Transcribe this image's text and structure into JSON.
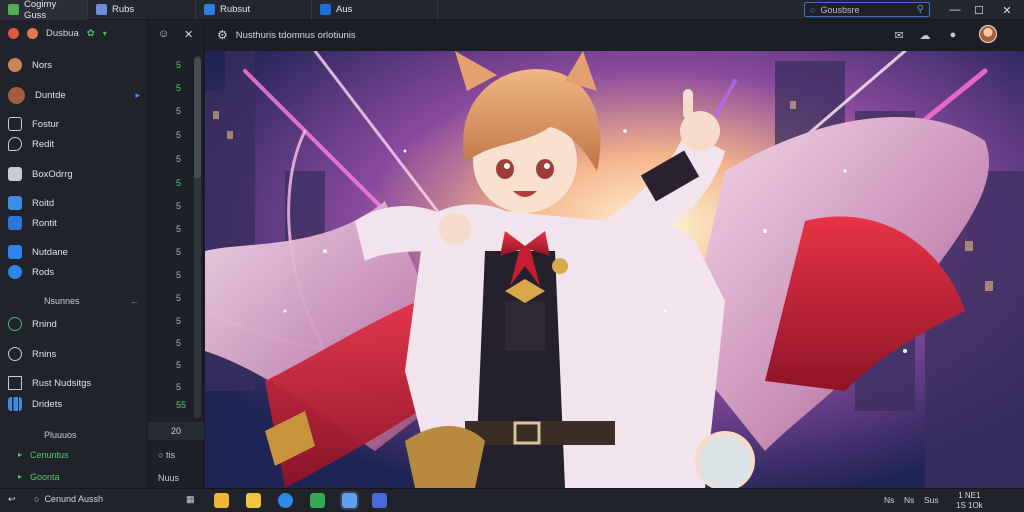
{
  "titlebar": {
    "tabs": [
      {
        "label": "Cogimy Guss",
        "icon_color": "#4caf50"
      },
      {
        "label": "Rubs",
        "icon_color": "#6b8cd6"
      },
      {
        "label": "Rubsut",
        "icon_color": "#2f7de1"
      },
      {
        "label": "Aus",
        "icon_color": "#1d6fe0"
      }
    ],
    "search_placeholder": "Gousbsre",
    "window_controls": [
      "minimize",
      "maximize",
      "close"
    ]
  },
  "sidebar": {
    "account_label": "Dusbua",
    "items": [
      {
        "label": "Nors",
        "icon": "avatar-icon",
        "color": "#c7855a"
      },
      {
        "label": "Duntde",
        "icon": "avatar-icon",
        "color": "#a65d3f",
        "chevron": true
      },
      {
        "label": "Fostur",
        "icon": "message-icon",
        "color": "#c8ccd2"
      },
      {
        "label": "Redit",
        "icon": "chat-icon",
        "color": "#c8ccd2"
      },
      {
        "label": "BoxOdrrg",
        "icon": "box-icon",
        "color": "#c8ccd2"
      },
      {
        "label": "Roitd",
        "icon": "cube-icon",
        "color": "#3b8de6"
      },
      {
        "label": "Rontit",
        "icon": "bag-icon",
        "color": "#2b78d8"
      },
      {
        "label": "Nutdane",
        "icon": "grid-icon",
        "color": "#2f86e8"
      },
      {
        "label": "Rods",
        "icon": "globe-icon",
        "color": "#2f86e8"
      }
    ],
    "section1": "Nsunnes",
    "items2": [
      {
        "label": "Rnind",
        "icon": "refresh-icon",
        "color": "#4fb36d"
      },
      {
        "label": "Rnins",
        "icon": "clock-icon",
        "color": "#c8ccd2"
      },
      {
        "label": "Rust Nudsitgs",
        "icon": "monitor-icon",
        "color": "#c8ccd2"
      },
      {
        "label": "Dridets",
        "icon": "chart-icon",
        "color": "#3b8de6"
      }
    ],
    "section2": "Pluuuos",
    "sub_items": [
      "Cenuntus",
      "Goonta"
    ]
  },
  "listcol": {
    "numbers": [
      "5",
      "5",
      "5",
      "5",
      "5",
      "5",
      "5",
      "5",
      "5",
      "5",
      "5",
      "5",
      "5",
      "5",
      "5",
      "55",
      "5"
    ],
    "pager": "20",
    "bottom_items": [
      "tis",
      "Nuus"
    ]
  },
  "main": {
    "breadcrumb": "Nusthuris tdomnus orlotiunis",
    "toolbar_icons": [
      "comment-icon",
      "cloud-icon",
      "record-icon"
    ]
  },
  "bottombar": {
    "back_label": "",
    "status": "Cenund Aussh",
    "tray": [
      "Ns",
      "Ns",
      "Sus"
    ],
    "clock_time": "1 NE1",
    "clock_date": "1S  1Ok"
  }
}
